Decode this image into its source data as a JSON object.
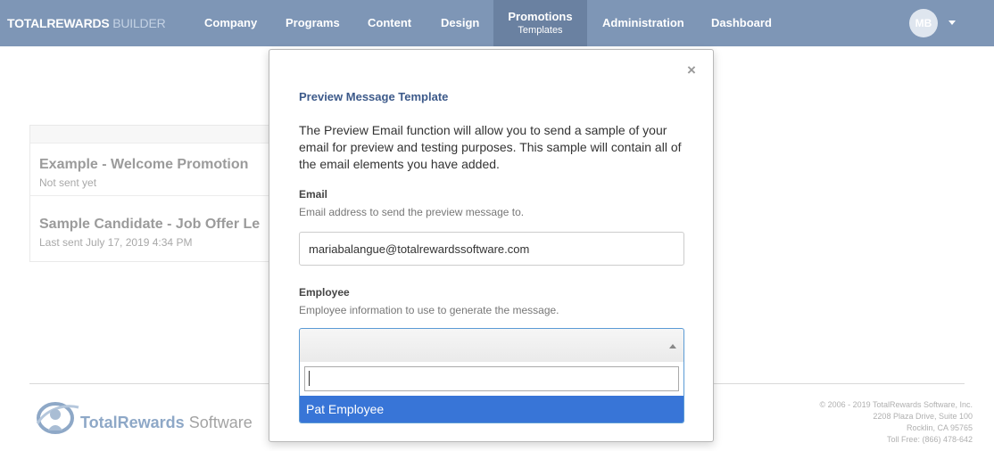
{
  "navbar": {
    "brand_main": "TOTALREWARDS",
    "brand_sub": "BUILDER",
    "items": [
      {
        "label": "Company"
      },
      {
        "label": "Programs"
      },
      {
        "label": "Content"
      },
      {
        "label": "Design"
      },
      {
        "label": "Promotions",
        "sublabel": "Templates",
        "active": true
      },
      {
        "label": "Administration"
      },
      {
        "label": "Dashboard"
      }
    ],
    "avatar_initials": "MB"
  },
  "list": {
    "items": [
      {
        "title": "Example - Welcome Promotion",
        "meta": "Not sent yet"
      },
      {
        "title": "Sample Candidate - Job Offer Le",
        "meta": "Last sent July 17, 2019 4:34 PM"
      }
    ]
  },
  "modal": {
    "close_symbol": "×",
    "title": "Preview Message Template",
    "description": "The Preview Email function will allow you to send a sample of your email for preview and testing purposes. This sample will contain all of the email elements you have added.",
    "email": {
      "label": "Email",
      "help": "Email address to send the preview message to.",
      "value": "mariabalangue@totalrewardssoftware.com"
    },
    "employee": {
      "label": "Employee",
      "help": "Employee information to use to generate the message.",
      "search_value": "",
      "options": [
        "Pat Employee"
      ]
    }
  },
  "footer": {
    "logo_text_bold": "TotalRewards",
    "logo_text_light": "Software",
    "copyright_lines": [
      "© 2006 - 2019 TotalRewards Software, Inc.",
      "2208 Plaza Drive, Suite 100",
      "Rocklin, CA 95765",
      "Toll Free: (866) 478-642"
    ]
  },
  "colors": {
    "navbar": "#7e96b6",
    "navbar_active": "#6a81a1",
    "modal_title": "#3d5a8a",
    "option_highlight": "#3875d7"
  }
}
